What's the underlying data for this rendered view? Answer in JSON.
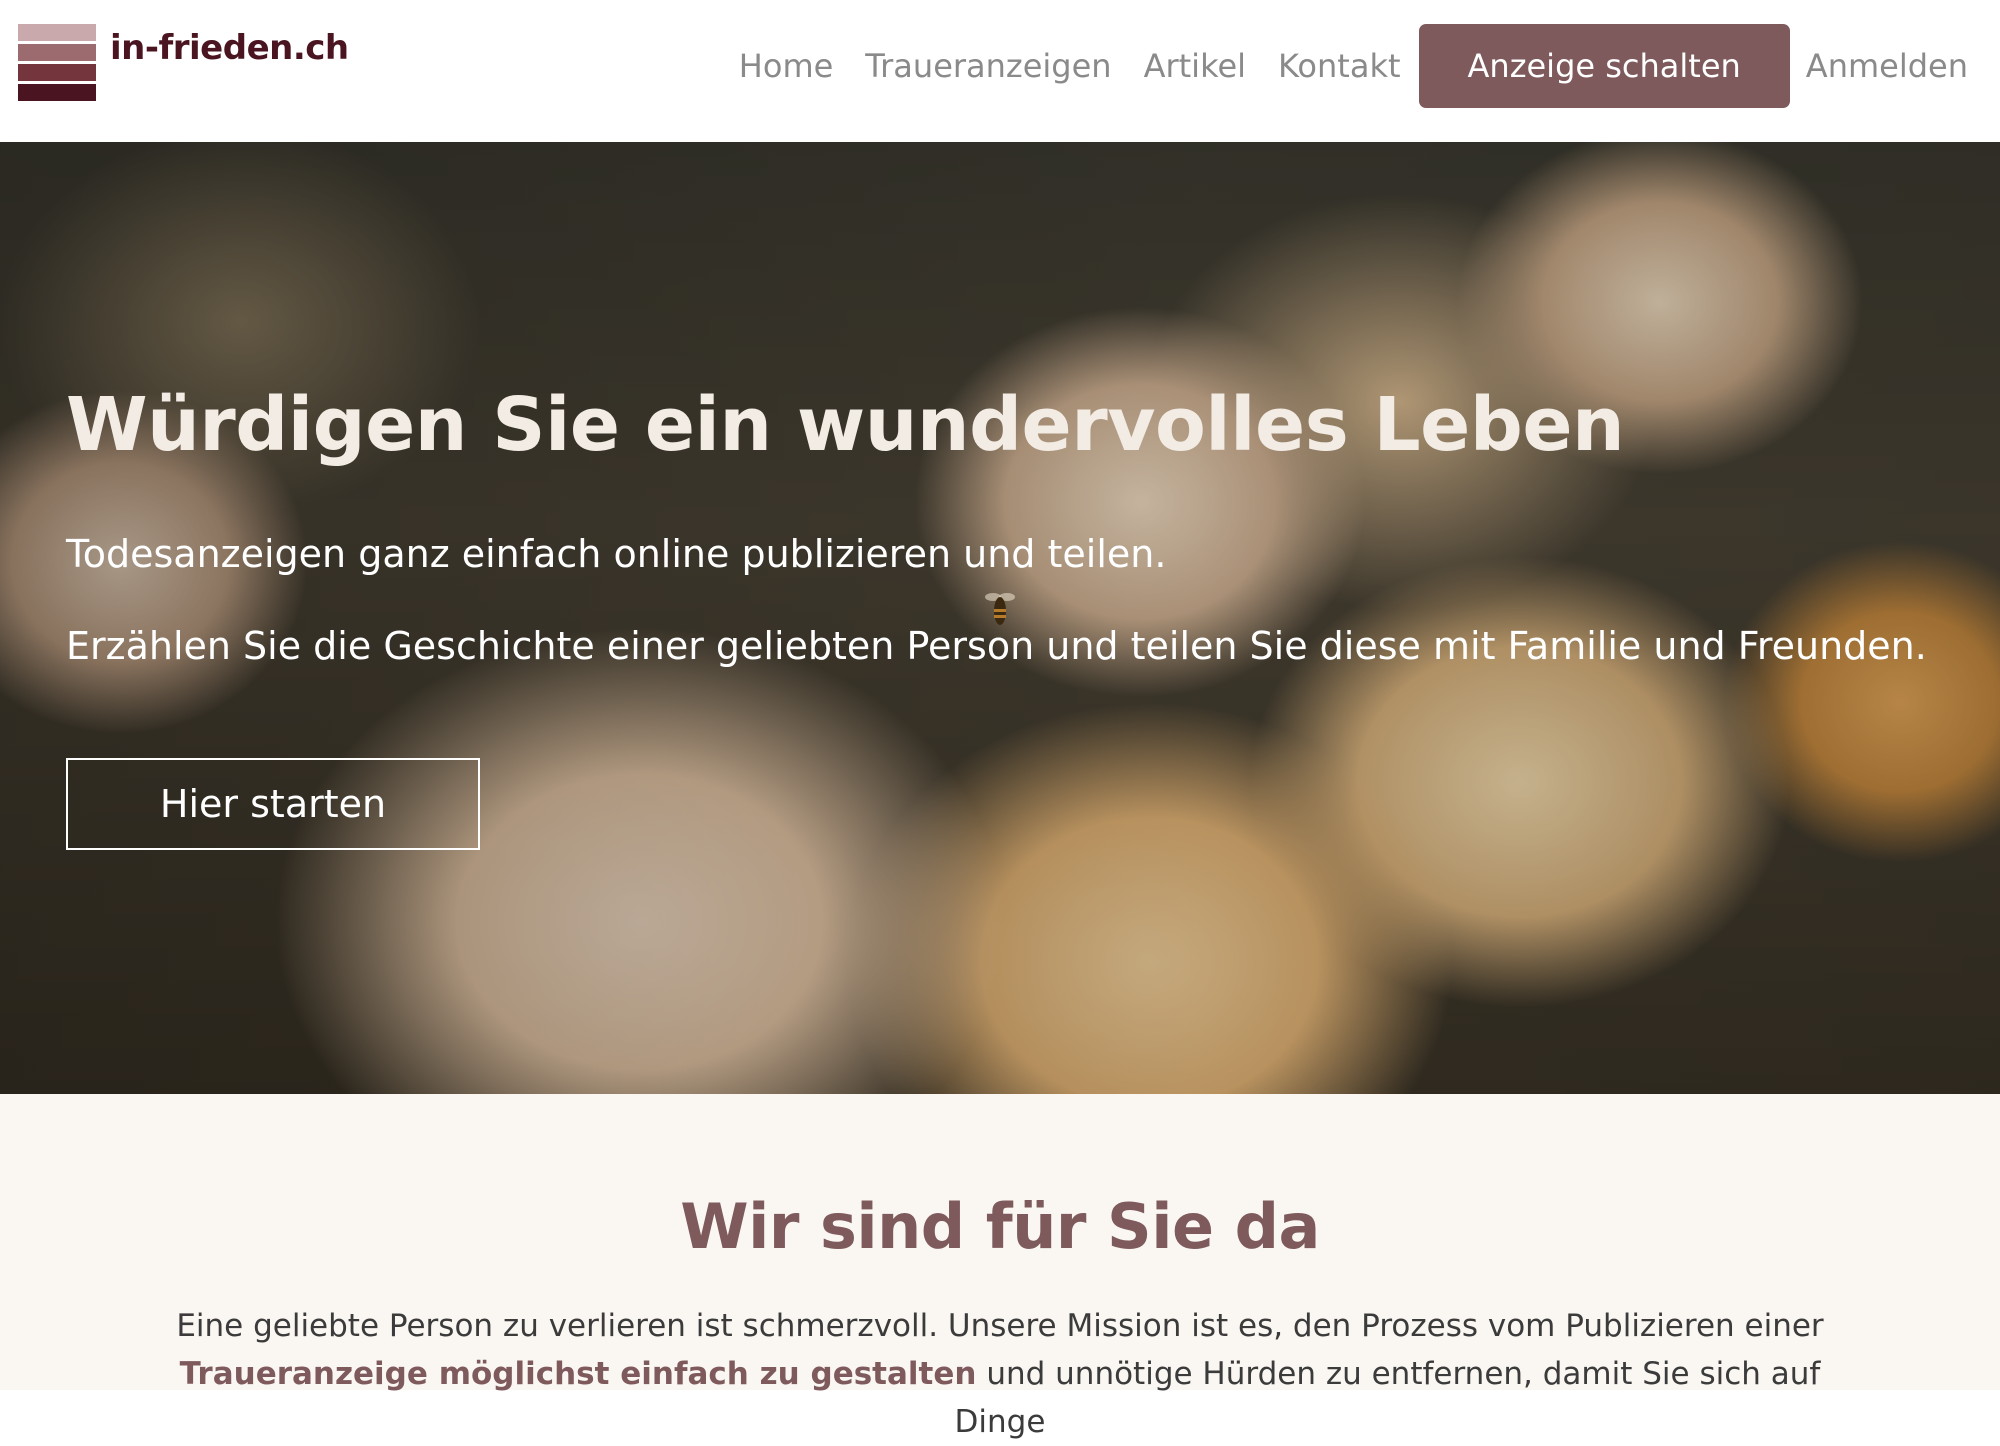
{
  "brand": {
    "name": "in-frieden.ch"
  },
  "nav": {
    "items": [
      "Home",
      "Traueranzeigen",
      "Artikel",
      "Kontakt"
    ],
    "cta": "Anzeige schalten",
    "login": "Anmelden"
  },
  "hero": {
    "title": "Würdigen Sie ein wundervolles Leben",
    "subtitle1": "Todesanzeigen ganz einfach online publizieren und teilen.",
    "subtitle2": "Erzählen Sie die Geschichte einer geliebten Person und teilen Sie diese mit Familie und Freunden.",
    "button": "Hier starten"
  },
  "about": {
    "title": "Wir sind für Sie da",
    "text_part1": "Eine geliebte Person zu verlieren ist schmerzvoll. Unsere Mission ist es, den Prozess vom Publizieren einer ",
    "text_highlight": "Traueranzeige möglichst einfach zu gestalten",
    "text_part2": " und unnötige Hürden zu entfernen, damit Sie sich auf Dinge"
  },
  "colors": {
    "brand_dark": "#4a1520",
    "accent": "#7e5a5c",
    "nav_text": "#8a8a8a",
    "section_bg": "#faf7f2"
  }
}
